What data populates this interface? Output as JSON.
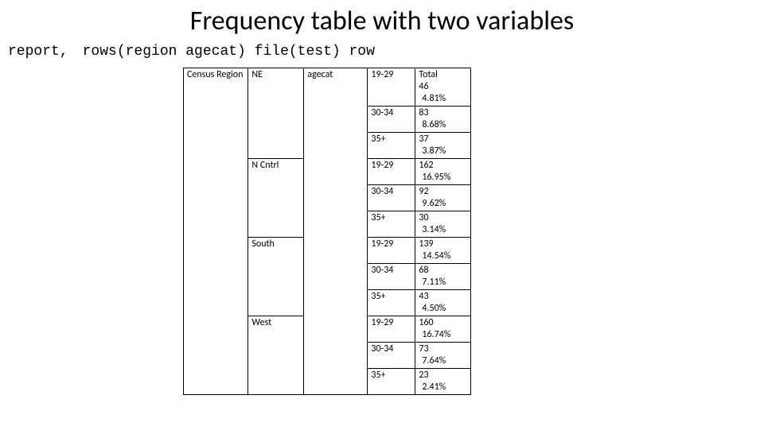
{
  "title": "Frequency table with two variables",
  "command": {
    "keyword": "report,",
    "args": "rows(region agecat) file(test) row"
  },
  "table": {
    "dim1_label": "Census Region",
    "dim3_label": "agecat",
    "total_label": "Total",
    "groups": [
      {
        "region": "NE",
        "rows": [
          {
            "cat": "19-29",
            "count": "46",
            "pct": "4.81%"
          },
          {
            "cat": "30-34",
            "count": "83",
            "pct": "8.68%"
          },
          {
            "cat": "35+",
            "count": "37",
            "pct": "3.87%"
          }
        ]
      },
      {
        "region": "N Cntrl",
        "rows": [
          {
            "cat": "19-29",
            "count": "162",
            "pct": "16.95%"
          },
          {
            "cat": "30-34",
            "count": "92",
            "pct": "9.62%"
          },
          {
            "cat": "35+",
            "count": "30",
            "pct": "3.14%"
          }
        ]
      },
      {
        "region": "South",
        "rows": [
          {
            "cat": "19-29",
            "count": "139",
            "pct": "14.54%"
          },
          {
            "cat": "30-34",
            "count": "68",
            "pct": "7.11%"
          },
          {
            "cat": "35+",
            "count": "43",
            "pct": "4.50%"
          }
        ]
      },
      {
        "region": "West",
        "rows": [
          {
            "cat": "19-29",
            "count": "160",
            "pct": "16.74%"
          },
          {
            "cat": "30-34",
            "count": "73",
            "pct": "7.64%"
          },
          {
            "cat": "35+",
            "count": "23",
            "pct": "2.41%"
          }
        ]
      }
    ]
  },
  "chart_data": {
    "type": "table",
    "row_var": "Census Region",
    "col_var": "agecat",
    "regions": [
      "NE",
      "N Cntrl",
      "South",
      "West"
    ],
    "agecats": [
      "19-29",
      "30-34",
      "35+"
    ],
    "counts": {
      "NE": {
        "19-29": 46,
        "30-34": 83,
        "35+": 37
      },
      "N Cntrl": {
        "19-29": 162,
        "30-34": 92,
        "35+": 30
      },
      "South": {
        "19-29": 139,
        "30-34": 68,
        "35+": 43
      },
      "West": {
        "19-29": 160,
        "30-34": 73,
        "35+": 23
      }
    },
    "row_percent": {
      "NE": {
        "19-29": 4.81,
        "30-34": 8.68,
        "35+": 3.87
      },
      "N Cntrl": {
        "19-29": 16.95,
        "30-34": 9.62,
        "35+": 3.14
      },
      "South": {
        "19-29": 14.54,
        "30-34": 7.11,
        "35+": 4.5
      },
      "West": {
        "19-29": 16.74,
        "30-34": 7.64,
        "35+": 2.41
      }
    }
  }
}
